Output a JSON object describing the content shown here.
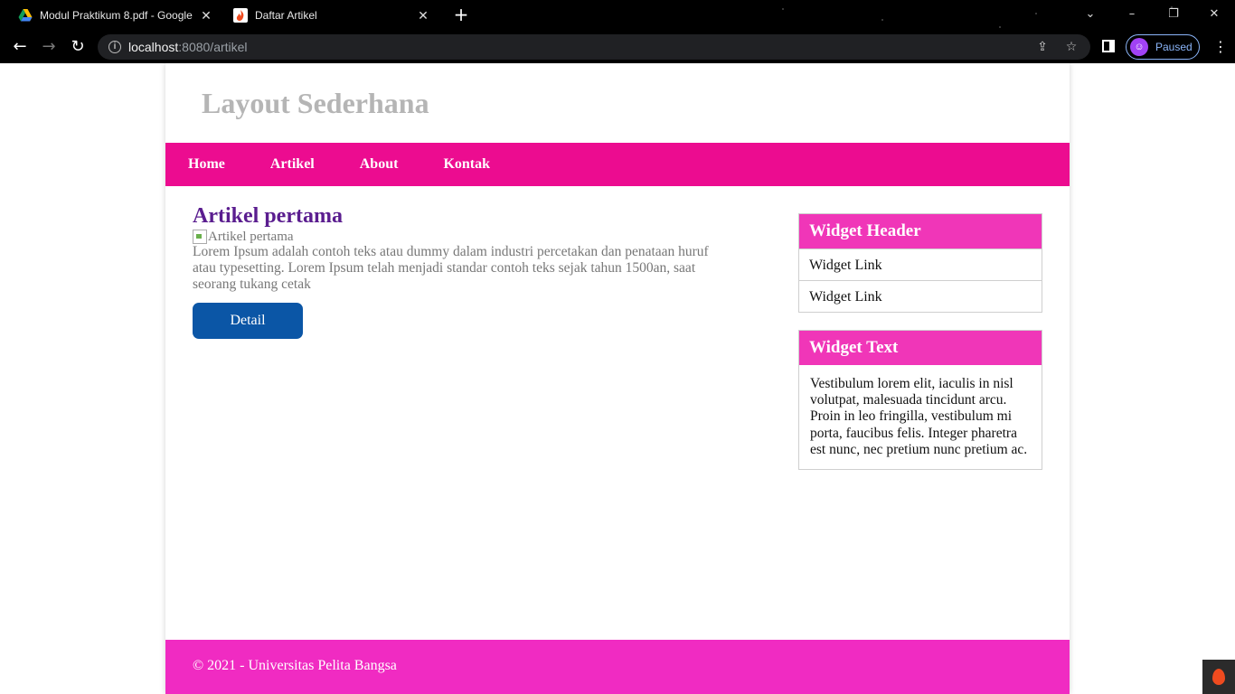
{
  "browser": {
    "tabs": [
      {
        "label": "Modul Praktikum 8.pdf - Google",
        "icon": "google-drive-icon",
        "active": false
      },
      {
        "label": "Daftar Artikel",
        "icon": "codeigniter-flame-icon",
        "active": true
      }
    ],
    "new_tab": "+",
    "url_host": "localhost",
    "url_path": ":8080/artikel",
    "profile_status": "Paused",
    "window_controls": {
      "minimize": "–",
      "restore": "❐",
      "close": "✕"
    }
  },
  "page": {
    "site_title": "Layout Sederhana",
    "nav": [
      "Home",
      "Artikel",
      "About",
      "Kontak"
    ],
    "article": {
      "title": "Artikel pertama",
      "image_alt": "Artikel pertama",
      "body": "Lorem Ipsum adalah contoh teks atau dummy dalam industri percetakan dan penataan huruf atau typesetting. Lorem Ipsum telah menjadi standar contoh teks sejak tahun 1500an, saat seorang tukang cetak",
      "button": "Detail"
    },
    "widget_header": {
      "title": "Widget Header",
      "links": [
        "Widget Link",
        "Widget Link"
      ]
    },
    "widget_text": {
      "title": "Widget Text",
      "text": "Vestibulum lorem elit, iaculis in nisl volutpat, malesuada tincidunt arcu. Proin in leo fringilla, vestibulum mi porta, faucibus felis. Integer pharetra est nunc, nec pretium nunc pretium ac."
    },
    "footer": "© 2021 - Universitas Pelita Bangsa"
  },
  "colors": {
    "nav_bg": "#ec0c90",
    "widget_head_bg": "#f036b8",
    "footer_bg": "#f02bc2",
    "button_bg": "#0b56a6",
    "article_title": "#5a1d8f"
  }
}
